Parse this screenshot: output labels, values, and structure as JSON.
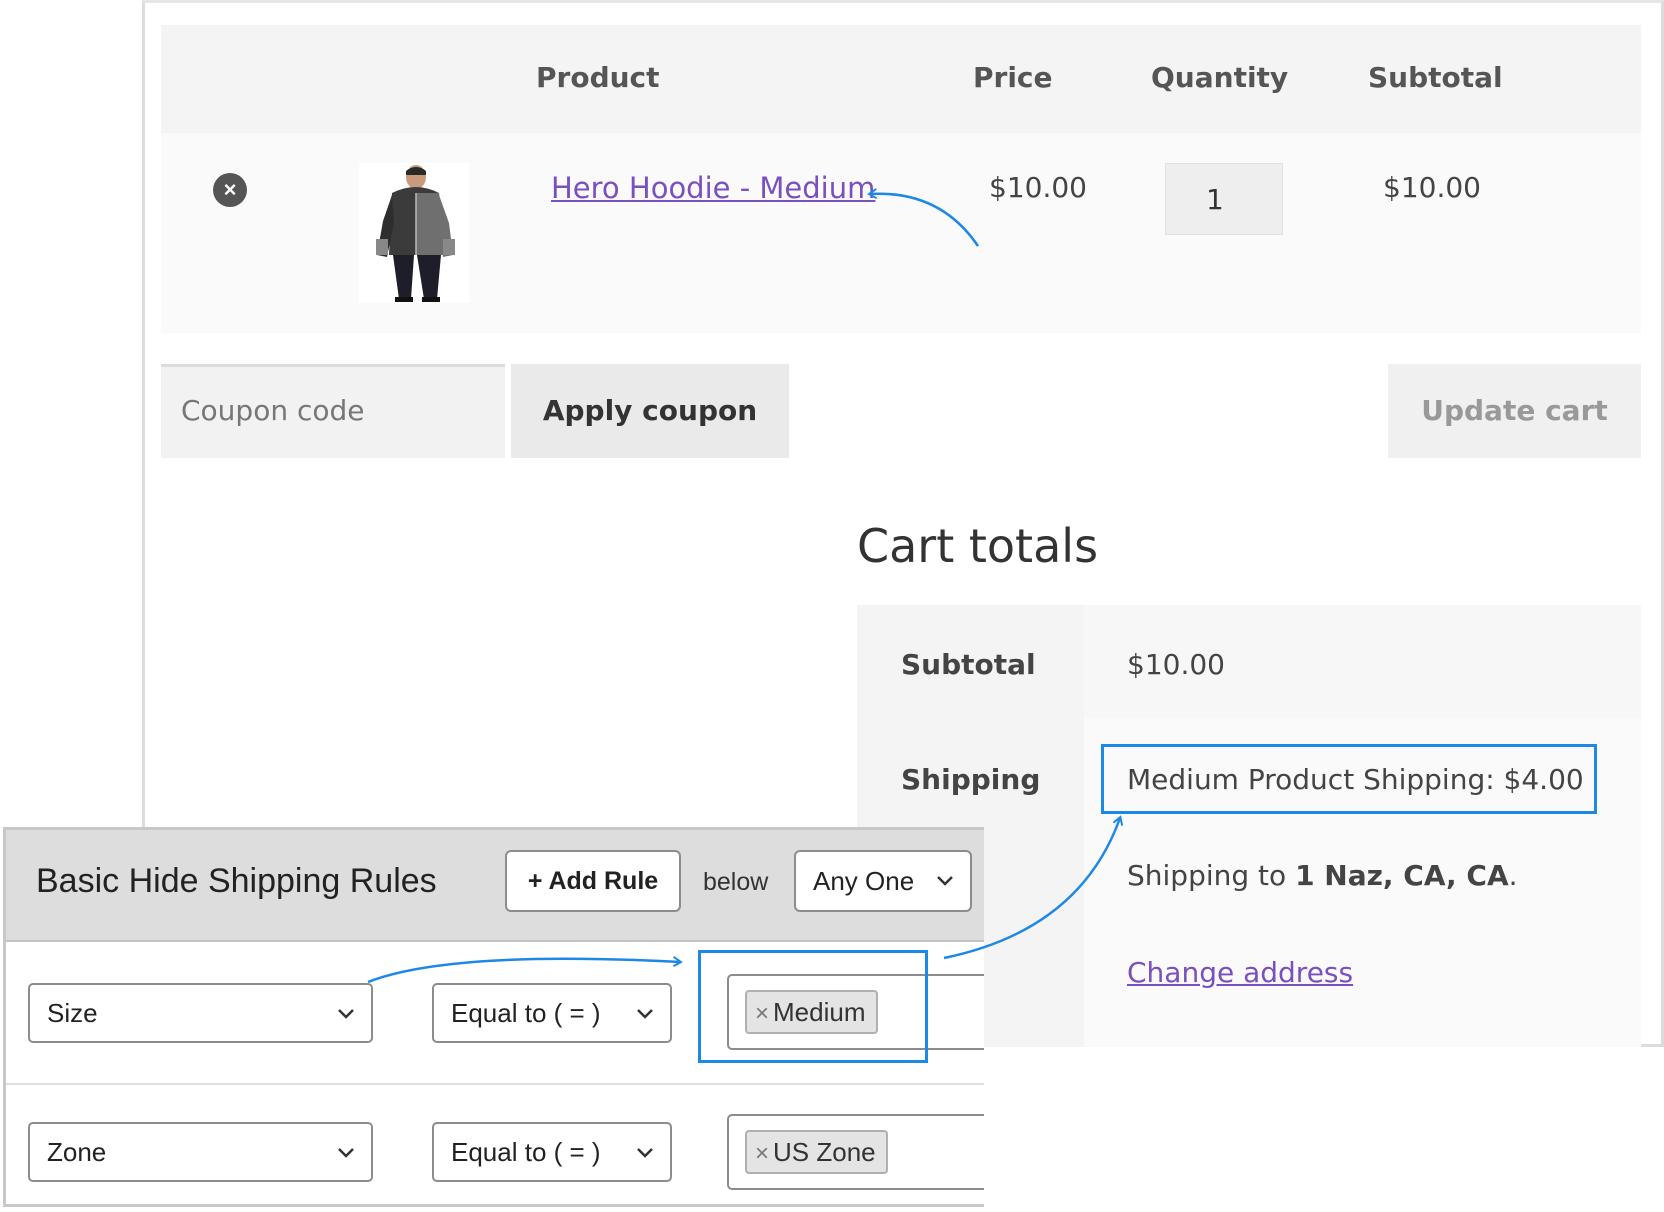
{
  "cart": {
    "headers": {
      "product": "Product",
      "price": "Price",
      "quantity": "Quantity",
      "subtotal": "Subtotal"
    },
    "item": {
      "name": "Hero Hoodie - Medium",
      "price": "$10.00",
      "quantity": "1",
      "subtotal": "$10.00"
    },
    "coupon_placeholder": "Coupon code",
    "apply_coupon_label": "Apply coupon",
    "update_cart_label": "Update cart"
  },
  "totals": {
    "title": "Cart totals",
    "subtotal_label": "Subtotal",
    "subtotal_value": "$10.00",
    "shipping_label": "Shipping",
    "shipping_method": "Medium Product Shipping: $4.00",
    "shipping_to_prefix": "Shipping to ",
    "shipping_to_address": "1 Naz, CA, CA",
    "shipping_to_suffix": ".",
    "change_address_label": "Change address"
  },
  "rules": {
    "title": "Basic Hide Shipping Rules",
    "add_rule_label": "+ Add Rule",
    "below_label": "below",
    "match_mode": "Any One",
    "rows": [
      {
        "field": "Size",
        "operator": "Equal to ( = )",
        "value": "Medium"
      },
      {
        "field": "Zone",
        "operator": "Equal to ( = )",
        "value": "US Zone"
      }
    ]
  },
  "icons": {
    "remove": "remove-circle-icon",
    "chevron": "chevron-down-icon",
    "token_remove": "token-remove-icon"
  },
  "colors": {
    "link": "#7a4fbf",
    "highlight": "#1e88e5",
    "header_bg": "#f4f4f4",
    "rules_header_bg": "#dddddd"
  }
}
